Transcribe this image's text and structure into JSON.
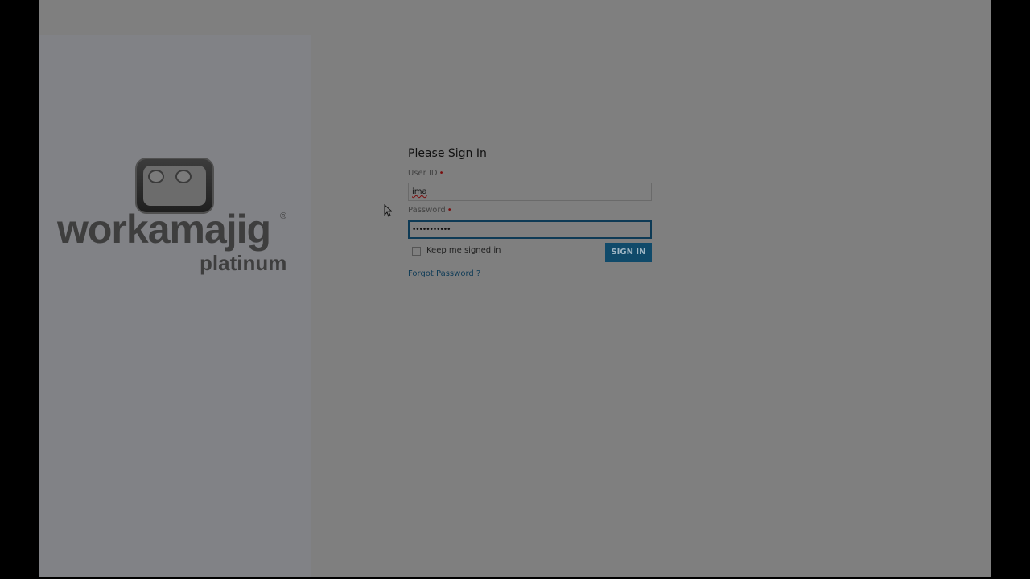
{
  "brand": {
    "name": "workamajig",
    "registered_mark": "®",
    "edition": "platinum"
  },
  "login": {
    "title": "Please Sign In",
    "user_id_label": "User ID",
    "user_id_value": "ima",
    "password_label": "Password",
    "password_value": "•••••••••••",
    "required_marker": "•",
    "keep_signed_in_label": "Keep me signed in",
    "keep_signed_in_checked": false,
    "sign_in_button": "SIGN IN",
    "forgot_password_link": "Forgot Password ?"
  },
  "colors": {
    "button": "#104a6a",
    "link": "#0e3b57",
    "required": "#7a0d0d"
  }
}
